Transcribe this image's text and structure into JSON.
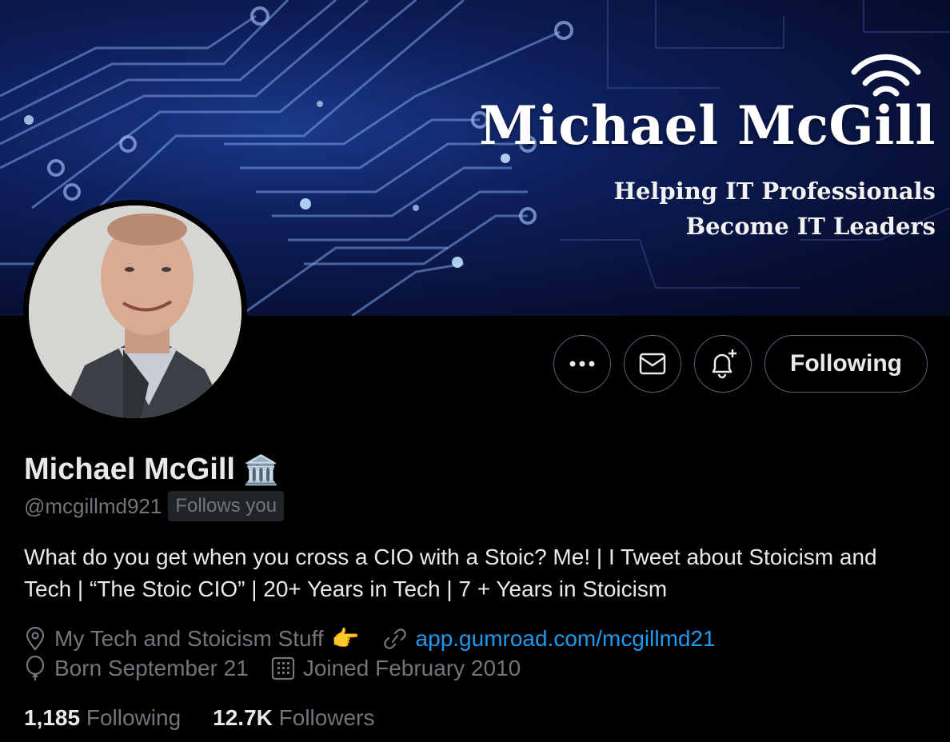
{
  "banner": {
    "name": "Michael McGill",
    "tagline_1": "Helping IT Professionals",
    "tagline_2": "Become IT Leaders"
  },
  "actions": {
    "more_icon": "more-icon",
    "message_icon": "envelope-icon",
    "notify_icon": "bell-plus-icon",
    "following_label": "Following"
  },
  "profile": {
    "display_name": "Michael McGill",
    "name_emoji": "🏛️",
    "handle": "@mcgillmd921",
    "follows_you": "Follows you",
    "bio": "What do you get when you cross a CIO with a Stoic? Me! | I Tweet about Stoicism and Tech | “The Stoic CIO” | 20+ Years in Tech | 7 + Years in Stoicism",
    "location": "My Tech and Stoicism Stuff",
    "location_emoji": "👉",
    "website": "app.gumroad.com/mcgillmd21",
    "birthday": "Born September 21",
    "joined": "Joined February 2010"
  },
  "stats": {
    "following_count": "1,185",
    "following_label": "Following",
    "followers_count": "12.7K",
    "followers_label": "Followers"
  },
  "colors": {
    "background": "#000000",
    "text": "#e7e9ea",
    "muted": "#71767b",
    "link": "#1d9bf0",
    "border": "#536471"
  }
}
